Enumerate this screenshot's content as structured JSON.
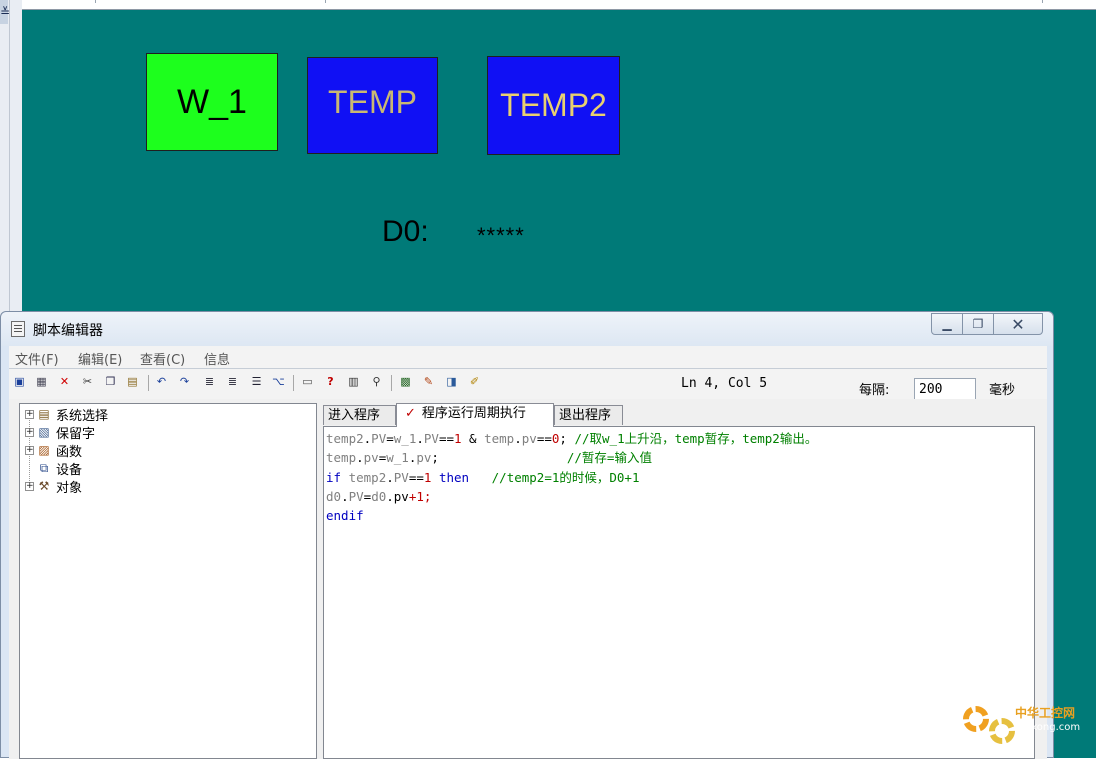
{
  "hmi": {
    "w1_label": "W_1",
    "temp_label": "TEMP",
    "temp2_label": "TEMP2",
    "d0_label": "D0:",
    "d0_value": "*****",
    "colors": {
      "canvas": "#007a78",
      "w1_bg": "#1dff1d",
      "temp_bg": "#1010f4"
    }
  },
  "editor": {
    "title": "脚本编辑器",
    "menu": [
      "文件(F)",
      "编辑(E)",
      "查看(C)",
      "信息"
    ],
    "status": "Ln 4, Col 5",
    "interval_label": "每隔:",
    "interval_value": "200",
    "interval_unit": "毫秒",
    "tree": [
      "系统选择",
      "保留字",
      "函数",
      "设备",
      "对象"
    ],
    "tabs": [
      "进入程序",
      "程序运行周期执行",
      "退出程序"
    ],
    "active_tab_mark": "✓",
    "code_lines": [
      [
        [
          "c-var",
          "temp2"
        ],
        [
          "c-op",
          "."
        ],
        [
          "c-var",
          "PV"
        ],
        [
          "c-op",
          "="
        ],
        [
          "c-var",
          "w_1"
        ],
        [
          "c-op",
          "."
        ],
        [
          "c-var",
          "PV"
        ],
        [
          "c-op",
          "=="
        ],
        [
          "c-num",
          "1"
        ],
        [
          "c-op",
          " & "
        ],
        [
          "c-var",
          "temp"
        ],
        [
          "c-op",
          "."
        ],
        [
          "c-var",
          "pv"
        ],
        [
          "c-op",
          "=="
        ],
        [
          "c-num",
          "0"
        ],
        [
          "c-op",
          ";"
        ],
        [
          "c-cm",
          " //取w_1上升沿，temp暂存，temp2输出。"
        ]
      ],
      [
        [
          "c-var",
          "temp"
        ],
        [
          "c-op",
          "."
        ],
        [
          "c-var",
          "pv"
        ],
        [
          "c-op",
          "="
        ],
        [
          "c-var",
          "w_1"
        ],
        [
          "c-op",
          "."
        ],
        [
          "c-var",
          "pv"
        ],
        [
          "c-op",
          ";"
        ],
        [
          "c-cm",
          "                 //暂存=输入值"
        ]
      ],
      [
        [
          "c-kw",
          "if"
        ],
        [
          "c-op",
          " "
        ],
        [
          "c-var",
          "temp2"
        ],
        [
          "c-op",
          "."
        ],
        [
          "c-var",
          "PV"
        ],
        [
          "c-op",
          "=="
        ],
        [
          "c-num",
          "1"
        ],
        [
          "c-op",
          " "
        ],
        [
          "c-kw",
          "then"
        ],
        [
          "c-cm",
          "   //temp2=1的时候，D0+1"
        ]
      ],
      [
        [
          "c-var",
          "d0"
        ],
        [
          "c-op",
          "."
        ],
        [
          "c-var",
          "PV"
        ],
        [
          "c-op",
          "="
        ],
        [
          "c-var",
          "d0"
        ],
        [
          "c-op",
          "."
        ],
        [
          "c-op",
          "pv"
        ],
        [
          "c-red",
          "+1;"
        ]
      ],
      [
        [
          "c-kw",
          "endif"
        ]
      ]
    ]
  },
  "watermark": {
    "text": "中华工控网",
    "sub": "gkong.com"
  }
}
